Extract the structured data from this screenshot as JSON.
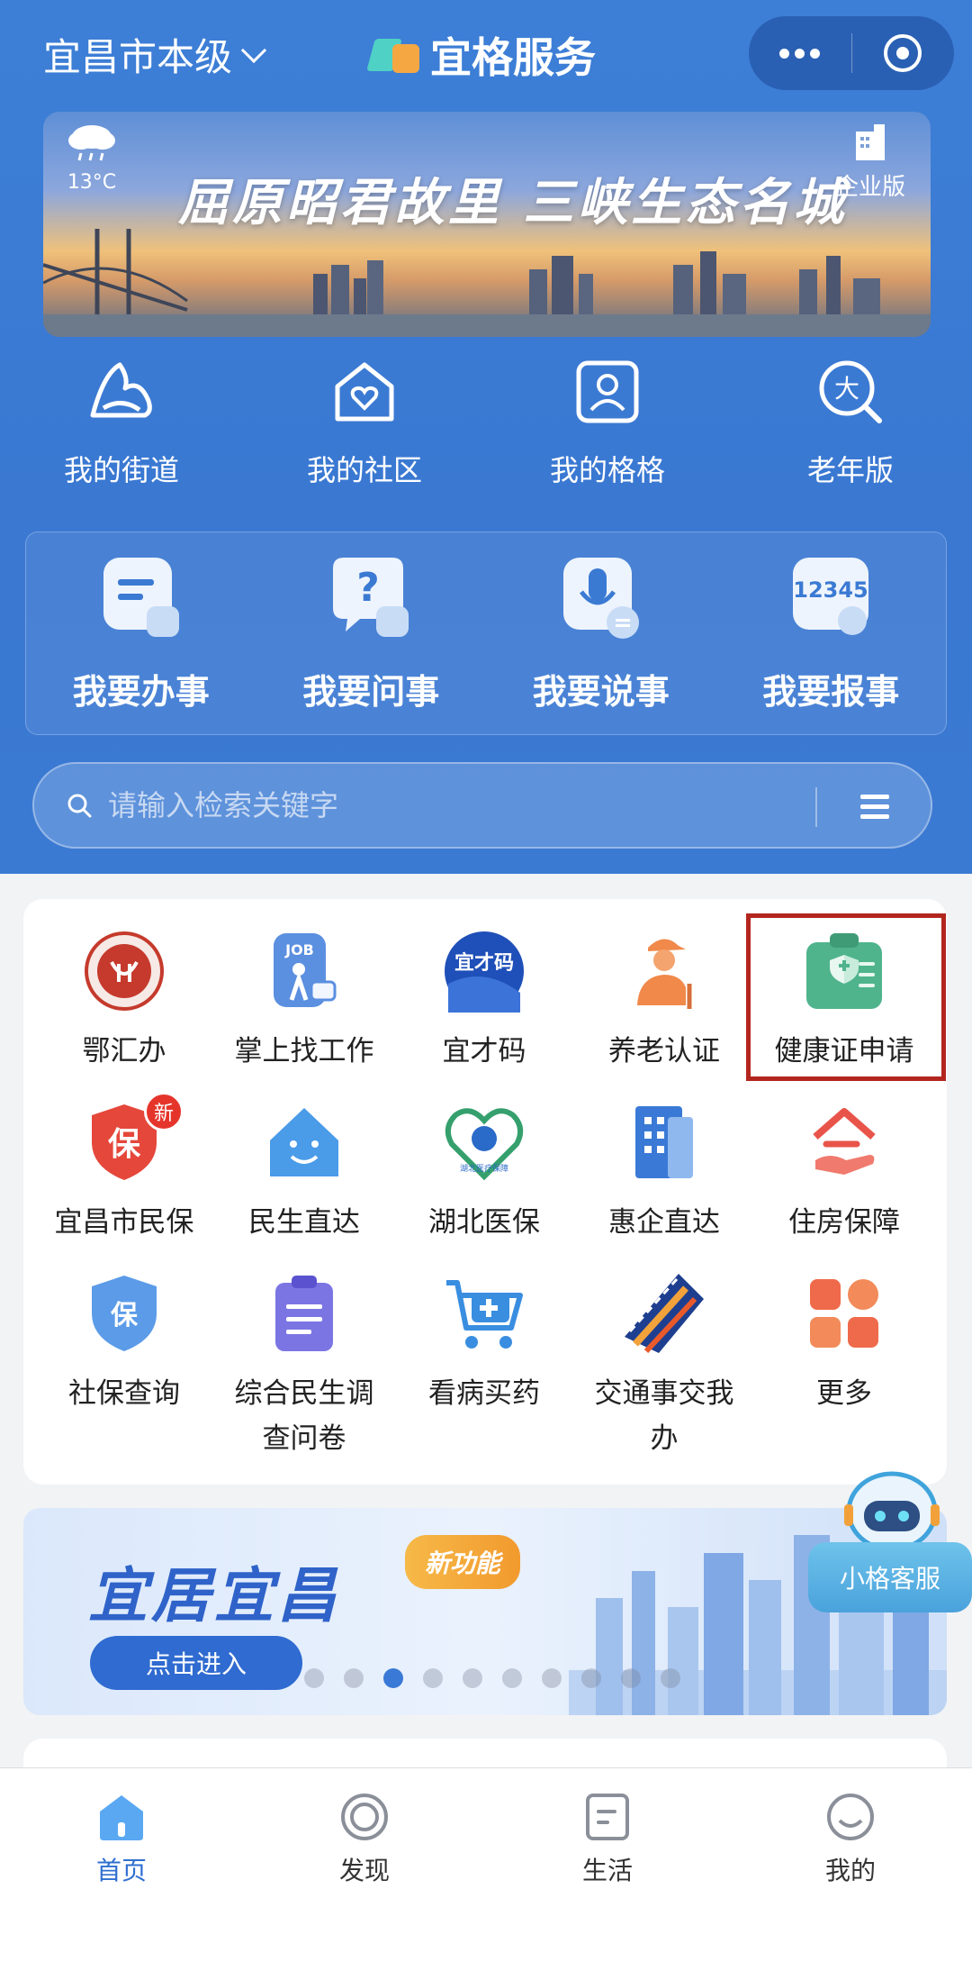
{
  "header": {
    "city": "宜昌市本级",
    "brand": "宜格服务"
  },
  "banner": {
    "weather_temp": "13°C",
    "slogan": "屈原昭君故里  三峡生态名城",
    "enterprise_label": "企业版"
  },
  "quick_nav": [
    {
      "label": "我的街道",
      "icon": "mountain-icon"
    },
    {
      "label": "我的社区",
      "icon": "heart-home-icon"
    },
    {
      "label": "我的格格",
      "icon": "user-card-icon"
    },
    {
      "label": "老年版",
      "icon": "elder-search-icon"
    }
  ],
  "actions": [
    {
      "label": "我要办事",
      "icon": "doc-pen-icon"
    },
    {
      "label": "我要问事",
      "icon": "question-bubble-icon"
    },
    {
      "label": "我要说事",
      "icon": "microphone-icon"
    },
    {
      "label": "我要报事",
      "icon": "hotline-icon",
      "icon_text": "12345"
    }
  ],
  "search": {
    "placeholder": "请输入检索关键字"
  },
  "services": [
    {
      "label": "鄂汇办",
      "icon": "ehuiban-icon"
    },
    {
      "label": "掌上找工作",
      "icon": "job-icon",
      "icon_text": "JOB"
    },
    {
      "label": "宜才码",
      "icon": "yicaima-icon",
      "icon_text": "宜才码"
    },
    {
      "label": "养老认证",
      "icon": "elder-icon"
    },
    {
      "label": "健康证申请",
      "icon": "health-certificate-icon"
    },
    {
      "label": "宜昌市民保",
      "icon": "insurance-shield-icon",
      "icon_text": "保",
      "badge": "新"
    },
    {
      "label": "民生直达",
      "icon": "smile-house-icon"
    },
    {
      "label": "湖北医保",
      "icon": "hubei-medical-icon",
      "icon_text": "湖北医疗保障"
    },
    {
      "label": "惠企直达",
      "icon": "building-icon"
    },
    {
      "label": "住房保障",
      "icon": "housing-hand-icon"
    },
    {
      "label": "社保查询",
      "icon": "social-security-icon",
      "icon_text": "保"
    },
    {
      "label": "综合民生调查问卷",
      "icon": "clipboard-icon"
    },
    {
      "label": "看病买药",
      "icon": "pharmacy-cart-icon"
    },
    {
      "label": "交通事交我办",
      "icon": "road-icon"
    },
    {
      "label": "更多",
      "icon": "grid-more-icon"
    }
  ],
  "promo": {
    "title": "宜居宜昌",
    "tag": "新功能",
    "button": "点击进入",
    "active_dot": 2
  },
  "agent": {
    "label": "小格客服"
  },
  "tabbar": [
    {
      "label": "首页",
      "icon": "home-icon",
      "active": true
    },
    {
      "label": "发现",
      "icon": "discover-icon",
      "active": false
    },
    {
      "label": "生活",
      "icon": "life-icon",
      "active": false
    },
    {
      "label": "我的",
      "icon": "profile-icon",
      "active": false
    }
  ],
  "colors": {
    "primary": "#3b7ad3",
    "highlight": "#b3261e",
    "tab_active": "#2f6fd0"
  }
}
